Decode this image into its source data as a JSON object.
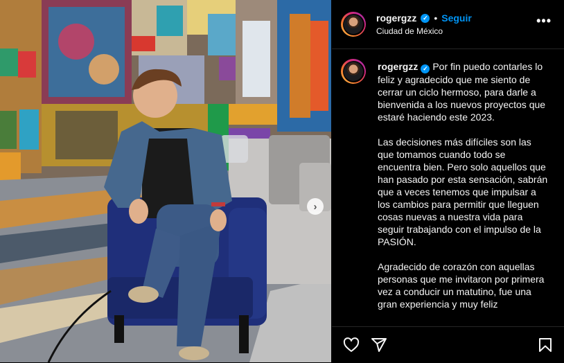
{
  "post": {
    "username": "rogergzz",
    "location": "Ciudad de México",
    "follow_label": "Seguir",
    "separator": "•",
    "more_label": "•••",
    "caption": "Por fin puedo contarles lo feliz y agradecido que me siento de cerrar un ciclo hermoso, para darle a bienvenida a los nuevos proyectos que estaré haciendo este 2023.\n\nLas decisiones más difíciles son las que tomamos cuando todo se encuentra bien. Pero solo aquellos que han pasado por esta sensación, sabrán que a veces tenemos que impulsar a los cambios para permitir que lleguen cosas nuevas a nuestra vida para seguir trabajando con el impulso de la PASIÓN.\n\nAgradecido de corazón con aquellas personas que me invitaron por primera vez a conducir un matutino, fue una gran experiencia y muy feliz"
  },
  "icons": {
    "verified": "verified-badge-icon",
    "like": "heart-icon",
    "share": "paper-plane-icon",
    "save": "bookmark-icon",
    "next": "chevron-right-icon"
  },
  "colors": {
    "background": "#000000",
    "accent": "#0095f6",
    "text": "#f5f5f5",
    "divider": "#262626"
  }
}
